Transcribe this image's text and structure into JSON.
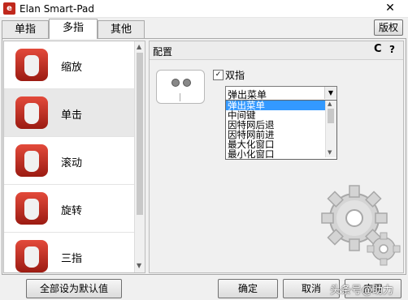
{
  "window": {
    "title": "Elan Smart-Pad",
    "close_glyph": "✕",
    "app_icon": "elan-app-icon"
  },
  "tabs": [
    {
      "label": "单指"
    },
    {
      "label": "多指",
      "active": true
    },
    {
      "label": "其他"
    }
  ],
  "version_button": "版权",
  "gestures": [
    {
      "label": "缩放",
      "icon": "pinch-hand-icon"
    },
    {
      "label": "单击",
      "icon": "tap-hand-icon",
      "selected": true
    },
    {
      "label": "滚动",
      "icon": "scroll-hand-icon"
    },
    {
      "label": "旋转",
      "icon": "rotate-hand-icon"
    },
    {
      "label": "三指",
      "icon": "three-finger-hand-icon"
    }
  ],
  "config": {
    "header": "配置",
    "refresh_glyph": "C",
    "help_glyph": "?",
    "checkbox_label": "双指",
    "checkbox_mark": "✓",
    "combo_value": "弹出菜单",
    "options": [
      "弹出菜单",
      "中间键",
      "因特网后退",
      "因特网前进",
      "最大化窗口",
      "最小化窗口"
    ]
  },
  "buttons": {
    "reset": "全部设为默认值",
    "ok": "确定",
    "cancel": "取消",
    "apply": "应用"
  },
  "watermark": "头条号@助力",
  "colors": {
    "accent": "#3399ff",
    "icon_red": "#c0281c"
  }
}
